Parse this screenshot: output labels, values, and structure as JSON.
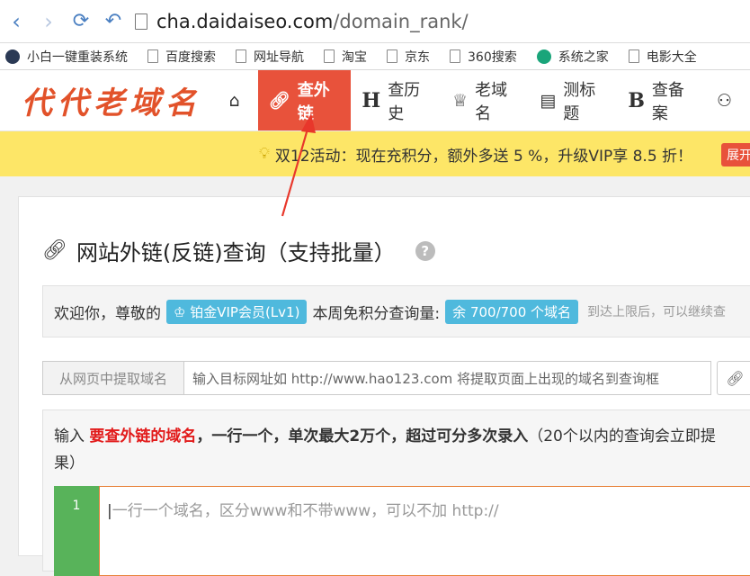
{
  "browser": {
    "url_host": "cha.daidaiseo.com",
    "url_path": "/domain_rank/"
  },
  "bookmarks": [
    {
      "label": "小白一键重装系统",
      "icon": "xiaobai-logo-icon"
    },
    {
      "label": "百度搜索",
      "icon": "page-icon"
    },
    {
      "label": "网址导航",
      "icon": "page-icon"
    },
    {
      "label": "淘宝",
      "icon": "page-icon"
    },
    {
      "label": "京东",
      "icon": "page-icon"
    },
    {
      "label": "360搜索",
      "icon": "page-icon"
    },
    {
      "label": "系统之家",
      "icon": "xitong-logo-icon"
    },
    {
      "label": "电影大全",
      "icon": "page-icon"
    }
  ],
  "site": {
    "logo": "代代老域名",
    "nav": [
      {
        "label": "",
        "icon": "home-icon"
      },
      {
        "label": "查外链",
        "icon": "link-icon",
        "active": true
      },
      {
        "label": "查历史",
        "icon": "h-letter-icon"
      },
      {
        "label": "老域名",
        "icon": "trophy-icon"
      },
      {
        "label": "测标题",
        "icon": "document-icon"
      },
      {
        "label": "查备案",
        "icon": "b-letter-icon"
      },
      {
        "label": "",
        "icon": "users-icon"
      }
    ]
  },
  "notice": {
    "text": "双12活动：现在充积分，额外多送 5 %，升级VIP享 8.5 折！",
    "button": "展开"
  },
  "main": {
    "title": "网站外链(反链)查询（支持批量）",
    "help": "?",
    "welcome_prefix": "欢迎你，尊敬的",
    "vip_badge": "铂金VIP会员(Lv1)",
    "quota_label": "本周免积分查询量:",
    "quota_badge": "余 700/700 个域名",
    "quota_hint": "到达上限后，可以继续查",
    "extract_label": "从网页中提取域名",
    "extract_placeholder": "输入目标网址如 http://www.hao123.com 将提取页面上出现的域名到查询框",
    "inst_1": "输入",
    "inst_red": "要查外链的域名",
    "inst_2": "，一行一个，单次最大2万个，超过可分多次录入",
    "inst_3": "（20个以内的查询会立即提",
    "inst_4": "果）",
    "line_number": "1",
    "textarea_placeholder": "一行一个域名，区分www和不带www，可以不加 http://"
  },
  "colors": {
    "accent": "#e8523b",
    "notice_bg": "#fde667",
    "badge": "#4fb9dd",
    "gutter": "#58b35a"
  }
}
